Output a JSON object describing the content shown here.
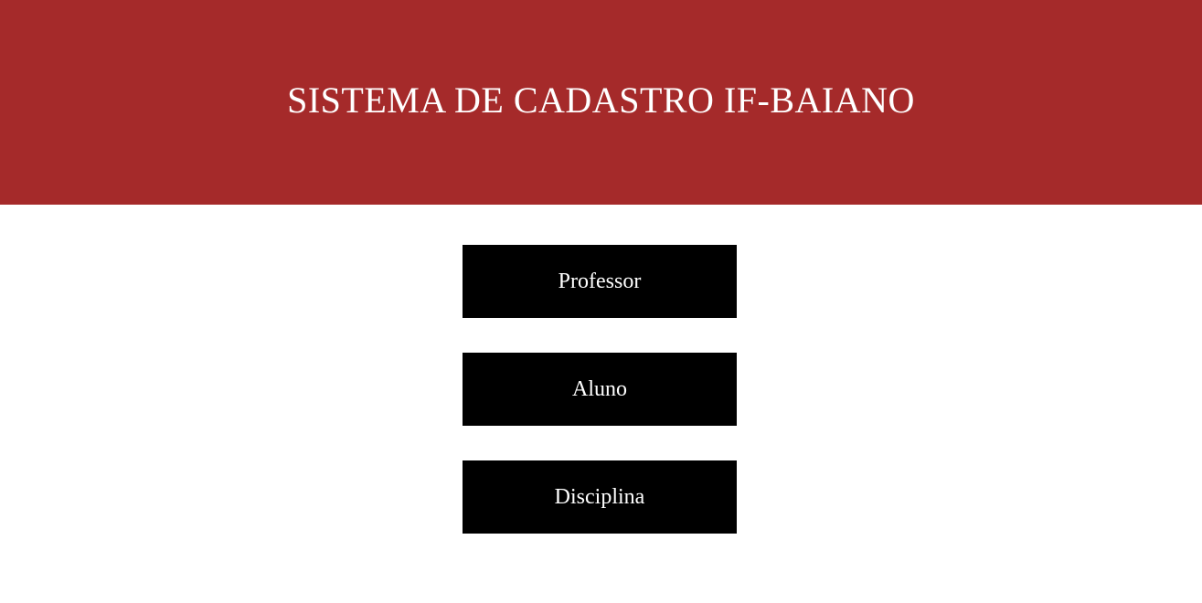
{
  "header": {
    "title": "SISTEMA DE CADASTRO IF-BAIANO"
  },
  "menu": {
    "buttons": [
      {
        "label": "Professor"
      },
      {
        "label": "Aluno"
      },
      {
        "label": "Disciplina"
      }
    ]
  },
  "colors": {
    "header_background": "#a52a2a",
    "button_background": "#000000",
    "button_text": "#ffffff",
    "page_background": "#ffffff"
  }
}
